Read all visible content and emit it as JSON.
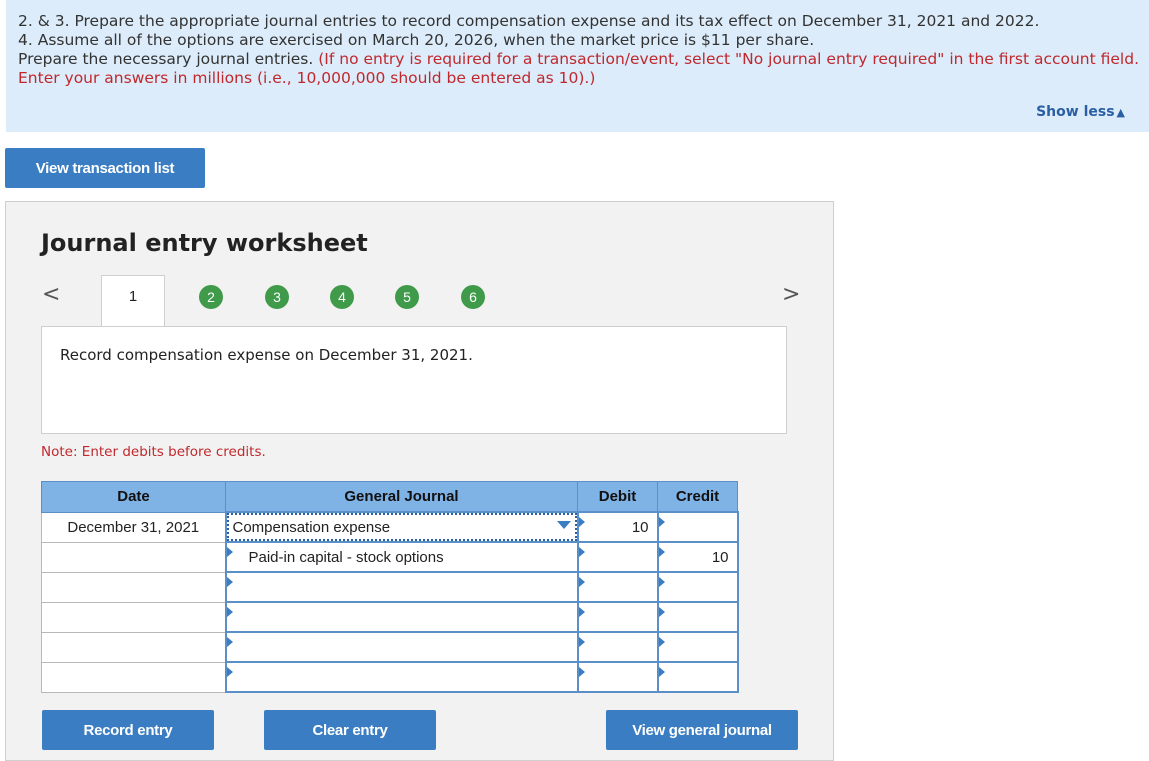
{
  "instructions": {
    "line1": "2. & 3. Prepare the appropriate journal entries to record compensation expense and its tax effect on December 31, 2021 and 2022.",
    "line2": "4. Assume all of the options are exercised on March 20, 2026, when the market price is $11 per share.",
    "line3_black": "Prepare the necessary journal entries.",
    "line3_red": "(If no entry is required for a transaction/event, select \"No journal entry required\" in the first account field. Enter your answers in millions (i.e., 10,000,000 should be entered as 10).)",
    "show_less": "Show less",
    "show_less_icon": "triangle-up-icon"
  },
  "buttons": {
    "view_transaction_list": "View transaction list",
    "record_entry": "Record entry",
    "clear_entry": "Clear entry",
    "view_general_journal": "View general journal"
  },
  "worksheet": {
    "title": "Journal entry worksheet",
    "prev_icon": "<",
    "next_icon": ">",
    "tabs": [
      "1",
      "2",
      "3",
      "4",
      "5",
      "6"
    ],
    "active_tab": "1",
    "description": "Record compensation expense on December 31, 2021.",
    "note": "Note: Enter debits before credits."
  },
  "journal": {
    "headers": {
      "date": "Date",
      "general_journal": "General Journal",
      "debit": "Debit",
      "credit": "Credit"
    },
    "rows": [
      {
        "date": "December 31, 2021",
        "account": "Compensation expense",
        "debit": "10",
        "credit": ""
      },
      {
        "date": "",
        "account": "Paid-in capital - stock options",
        "debit": "",
        "credit": "10"
      },
      {
        "date": "",
        "account": "",
        "debit": "",
        "credit": ""
      },
      {
        "date": "",
        "account": "",
        "debit": "",
        "credit": ""
      },
      {
        "date": "",
        "account": "",
        "debit": "",
        "credit": ""
      },
      {
        "date": "",
        "account": "",
        "debit": "",
        "credit": ""
      }
    ]
  },
  "colors": {
    "instruction_bg": "#dcecfa",
    "button_blue": "#3a7dc3",
    "tab_green": "#3f9a4a",
    "header_blue": "#7fb2e5",
    "note_red": "#c0282d"
  }
}
